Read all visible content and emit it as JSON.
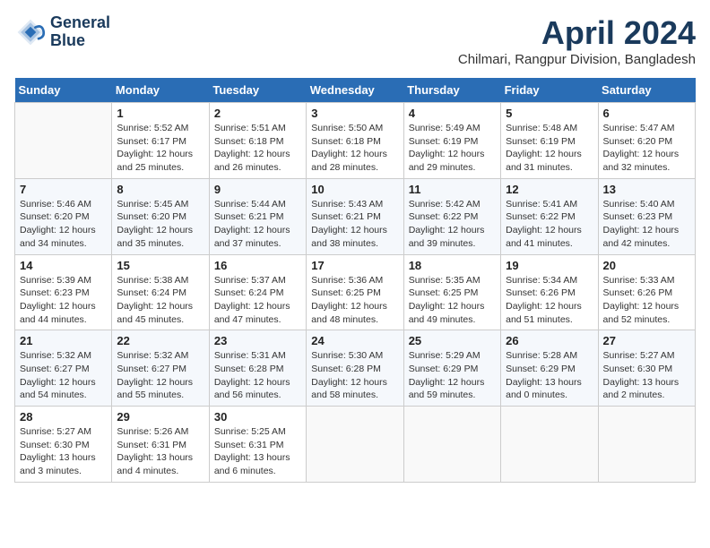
{
  "header": {
    "logo_line1": "General",
    "logo_line2": "Blue",
    "month": "April 2024",
    "location": "Chilmari, Rangpur Division, Bangladesh"
  },
  "weekdays": [
    "Sunday",
    "Monday",
    "Tuesday",
    "Wednesday",
    "Thursday",
    "Friday",
    "Saturday"
  ],
  "weeks": [
    [
      {
        "day": "",
        "info": ""
      },
      {
        "day": "1",
        "info": "Sunrise: 5:52 AM\nSunset: 6:17 PM\nDaylight: 12 hours\nand 25 minutes."
      },
      {
        "day": "2",
        "info": "Sunrise: 5:51 AM\nSunset: 6:18 PM\nDaylight: 12 hours\nand 26 minutes."
      },
      {
        "day": "3",
        "info": "Sunrise: 5:50 AM\nSunset: 6:18 PM\nDaylight: 12 hours\nand 28 minutes."
      },
      {
        "day": "4",
        "info": "Sunrise: 5:49 AM\nSunset: 6:19 PM\nDaylight: 12 hours\nand 29 minutes."
      },
      {
        "day": "5",
        "info": "Sunrise: 5:48 AM\nSunset: 6:19 PM\nDaylight: 12 hours\nand 31 minutes."
      },
      {
        "day": "6",
        "info": "Sunrise: 5:47 AM\nSunset: 6:20 PM\nDaylight: 12 hours\nand 32 minutes."
      }
    ],
    [
      {
        "day": "7",
        "info": "Sunrise: 5:46 AM\nSunset: 6:20 PM\nDaylight: 12 hours\nand 34 minutes."
      },
      {
        "day": "8",
        "info": "Sunrise: 5:45 AM\nSunset: 6:20 PM\nDaylight: 12 hours\nand 35 minutes."
      },
      {
        "day": "9",
        "info": "Sunrise: 5:44 AM\nSunset: 6:21 PM\nDaylight: 12 hours\nand 37 minutes."
      },
      {
        "day": "10",
        "info": "Sunrise: 5:43 AM\nSunset: 6:21 PM\nDaylight: 12 hours\nand 38 minutes."
      },
      {
        "day": "11",
        "info": "Sunrise: 5:42 AM\nSunset: 6:22 PM\nDaylight: 12 hours\nand 39 minutes."
      },
      {
        "day": "12",
        "info": "Sunrise: 5:41 AM\nSunset: 6:22 PM\nDaylight: 12 hours\nand 41 minutes."
      },
      {
        "day": "13",
        "info": "Sunrise: 5:40 AM\nSunset: 6:23 PM\nDaylight: 12 hours\nand 42 minutes."
      }
    ],
    [
      {
        "day": "14",
        "info": "Sunrise: 5:39 AM\nSunset: 6:23 PM\nDaylight: 12 hours\nand 44 minutes."
      },
      {
        "day": "15",
        "info": "Sunrise: 5:38 AM\nSunset: 6:24 PM\nDaylight: 12 hours\nand 45 minutes."
      },
      {
        "day": "16",
        "info": "Sunrise: 5:37 AM\nSunset: 6:24 PM\nDaylight: 12 hours\nand 47 minutes."
      },
      {
        "day": "17",
        "info": "Sunrise: 5:36 AM\nSunset: 6:25 PM\nDaylight: 12 hours\nand 48 minutes."
      },
      {
        "day": "18",
        "info": "Sunrise: 5:35 AM\nSunset: 6:25 PM\nDaylight: 12 hours\nand 49 minutes."
      },
      {
        "day": "19",
        "info": "Sunrise: 5:34 AM\nSunset: 6:26 PM\nDaylight: 12 hours\nand 51 minutes."
      },
      {
        "day": "20",
        "info": "Sunrise: 5:33 AM\nSunset: 6:26 PM\nDaylight: 12 hours\nand 52 minutes."
      }
    ],
    [
      {
        "day": "21",
        "info": "Sunrise: 5:32 AM\nSunset: 6:27 PM\nDaylight: 12 hours\nand 54 minutes."
      },
      {
        "day": "22",
        "info": "Sunrise: 5:32 AM\nSunset: 6:27 PM\nDaylight: 12 hours\nand 55 minutes."
      },
      {
        "day": "23",
        "info": "Sunrise: 5:31 AM\nSunset: 6:28 PM\nDaylight: 12 hours\nand 56 minutes."
      },
      {
        "day": "24",
        "info": "Sunrise: 5:30 AM\nSunset: 6:28 PM\nDaylight: 12 hours\nand 58 minutes."
      },
      {
        "day": "25",
        "info": "Sunrise: 5:29 AM\nSunset: 6:29 PM\nDaylight: 12 hours\nand 59 minutes."
      },
      {
        "day": "26",
        "info": "Sunrise: 5:28 AM\nSunset: 6:29 PM\nDaylight: 13 hours\nand 0 minutes."
      },
      {
        "day": "27",
        "info": "Sunrise: 5:27 AM\nSunset: 6:30 PM\nDaylight: 13 hours\nand 2 minutes."
      }
    ],
    [
      {
        "day": "28",
        "info": "Sunrise: 5:27 AM\nSunset: 6:30 PM\nDaylight: 13 hours\nand 3 minutes."
      },
      {
        "day": "29",
        "info": "Sunrise: 5:26 AM\nSunset: 6:31 PM\nDaylight: 13 hours\nand 4 minutes."
      },
      {
        "day": "30",
        "info": "Sunrise: 5:25 AM\nSunset: 6:31 PM\nDaylight: 13 hours\nand 6 minutes."
      },
      {
        "day": "",
        "info": ""
      },
      {
        "day": "",
        "info": ""
      },
      {
        "day": "",
        "info": ""
      },
      {
        "day": "",
        "info": ""
      }
    ]
  ]
}
